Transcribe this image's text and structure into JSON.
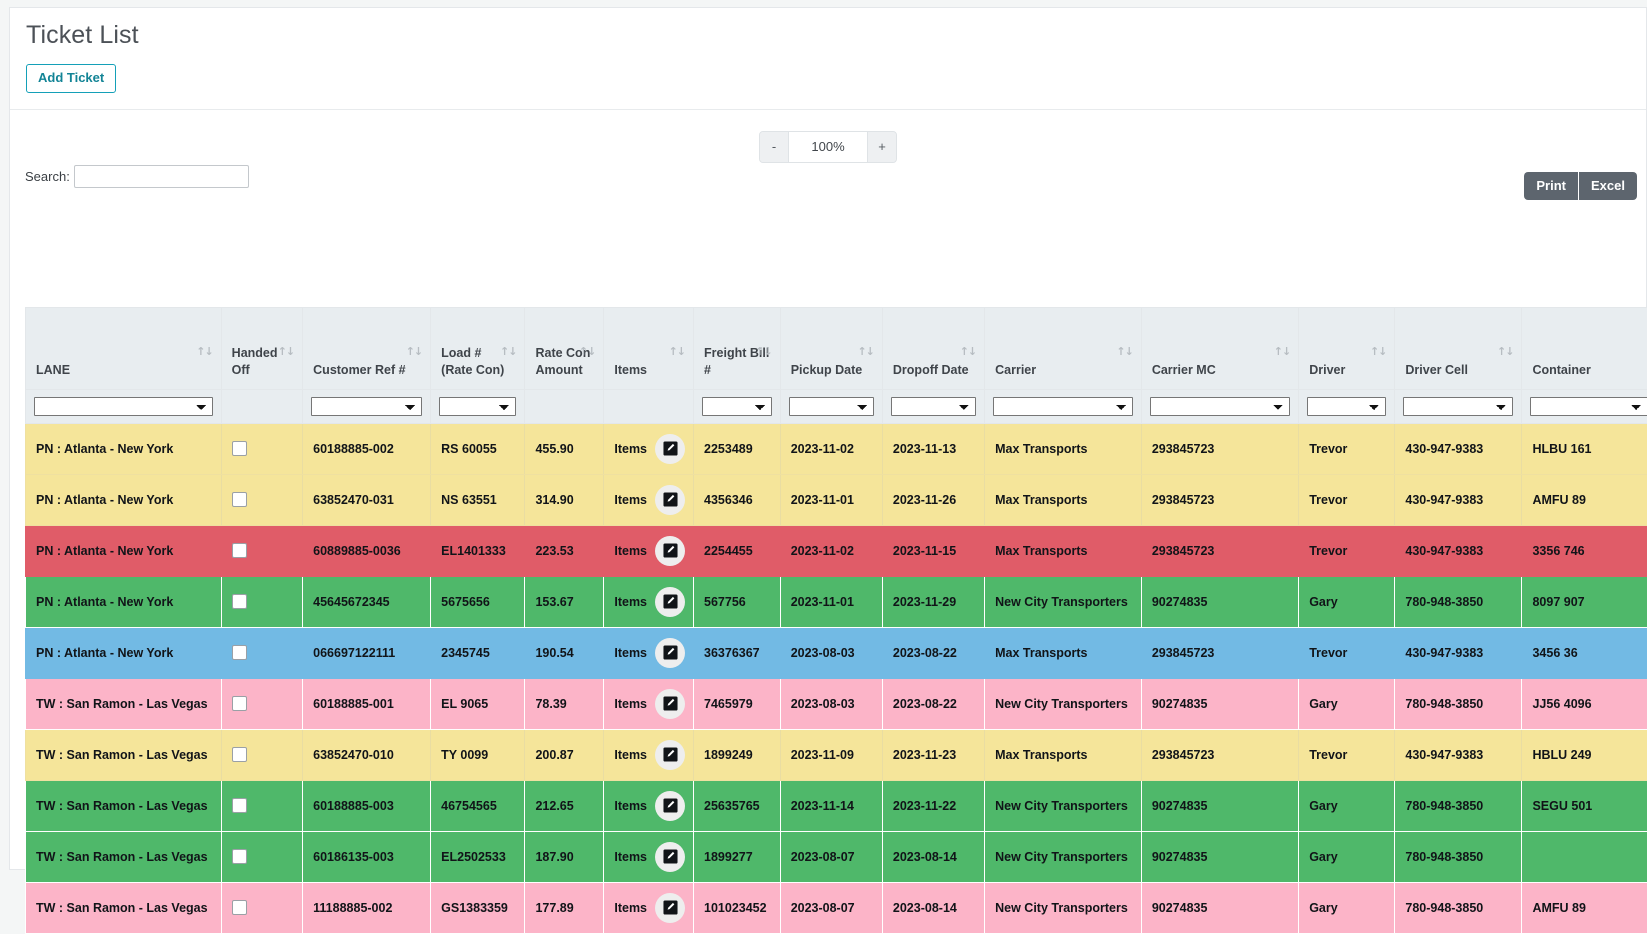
{
  "page": {
    "title": "Ticket List",
    "add_ticket_label": "Add Ticket"
  },
  "zoom": {
    "minus_label": "-",
    "value": "100%",
    "plus_label": "+"
  },
  "export": {
    "print_label": "Print",
    "excel_label": "Excel"
  },
  "search": {
    "label": "Search:",
    "value": "",
    "placeholder": ""
  },
  "table": {
    "columns": [
      {
        "key": "lane",
        "label": "LANE",
        "sortable": true,
        "filter": true
      },
      {
        "key": "handed_off",
        "label": "Handed Off",
        "sortable": true,
        "filter": false
      },
      {
        "key": "customer_ref",
        "label": "Customer Ref #",
        "sortable": true,
        "filter": true
      },
      {
        "key": "load",
        "label": "Load # (Rate Con)",
        "sortable": true,
        "filter": true
      },
      {
        "key": "rate_con_amount",
        "label": "Rate Con Amount",
        "sortable": true,
        "filter": false
      },
      {
        "key": "items",
        "label": "Items",
        "sortable": true,
        "filter": false
      },
      {
        "key": "freight_bill",
        "label": "Freight Bill #",
        "sortable": true,
        "filter": true
      },
      {
        "key": "pickup_date",
        "label": "Pickup Date",
        "sortable": true,
        "filter": true
      },
      {
        "key": "dropoff_date",
        "label": "Dropoff Date",
        "sortable": true,
        "filter": true
      },
      {
        "key": "carrier",
        "label": "Carrier",
        "sortable": true,
        "filter": true
      },
      {
        "key": "carrier_mc",
        "label": "Carrier MC",
        "sortable": true,
        "filter": true
      },
      {
        "key": "driver",
        "label": "Driver",
        "sortable": true,
        "filter": true
      },
      {
        "key": "driver_cell",
        "label": "Driver Cell",
        "sortable": true,
        "filter": true
      },
      {
        "key": "container",
        "label": "Container",
        "sortable": false,
        "filter": true
      }
    ],
    "items_cell_label": "Items",
    "items_edit_icon": "edit-square-icon",
    "sort_icon": "sort-updown-icon",
    "row_colors": {
      "yellow": "#f5e59a",
      "red": "#e05c68",
      "green": "#4fb86a",
      "blue": "#72bae4",
      "pink": "#fcb4c8"
    },
    "rows": [
      {
        "color": "yellow",
        "lane": "PN : Atlanta - New York",
        "handed_off": false,
        "customer_ref": "60188885-002",
        "load": "RS 60055",
        "rate_con_amount": "455.90",
        "items": "Items",
        "freight_bill": "2253489",
        "pickup_date": "2023-11-02",
        "dropoff_date": "2023-11-13",
        "carrier": "Max Transports",
        "carrier_mc": "293845723",
        "driver": "Trevor",
        "driver_cell": "430-947-9383",
        "container": "HLBU 161"
      },
      {
        "color": "yellow",
        "lane": "PN : Atlanta - New York",
        "handed_off": false,
        "customer_ref": "63852470-031",
        "load": "NS 63551",
        "rate_con_amount": "314.90",
        "items": "Items",
        "freight_bill": "4356346",
        "pickup_date": "2023-11-01",
        "dropoff_date": "2023-11-26",
        "carrier": "Max Transports",
        "carrier_mc": "293845723",
        "driver": "Trevor",
        "driver_cell": "430-947-9383",
        "container": "AMFU 89"
      },
      {
        "color": "red",
        "lane": "PN : Atlanta - New York",
        "handed_off": false,
        "customer_ref": "60889885-0036",
        "load": "EL1401333",
        "rate_con_amount": "223.53",
        "items": "Items",
        "freight_bill": "2254455",
        "pickup_date": "2023-11-02",
        "dropoff_date": "2023-11-15",
        "carrier": "Max Transports",
        "carrier_mc": "293845723",
        "driver": "Trevor",
        "driver_cell": "430-947-9383",
        "container": "3356 746"
      },
      {
        "color": "green",
        "lane": "PN : Atlanta - New York",
        "handed_off": false,
        "customer_ref": "45645672345",
        "load": "5675656",
        "rate_con_amount": "153.67",
        "items": "Items",
        "freight_bill": "567756",
        "pickup_date": "2023-11-01",
        "dropoff_date": "2023-11-29",
        "carrier": "New City Transporters",
        "carrier_mc": "90274835",
        "driver": "Gary",
        "driver_cell": "780-948-3850",
        "container": "8097 907"
      },
      {
        "color": "blue",
        "lane": "PN : Atlanta - New York",
        "handed_off": false,
        "customer_ref": "066697122111",
        "load": "2345745",
        "rate_con_amount": "190.54",
        "items": "Items",
        "freight_bill": "36376367",
        "pickup_date": "2023-08-03",
        "dropoff_date": "2023-08-22",
        "carrier": "Max Transports",
        "carrier_mc": "293845723",
        "driver": "Trevor",
        "driver_cell": "430-947-9383",
        "container": "3456 36"
      },
      {
        "color": "pink",
        "lane": "TW : San Ramon - Las Vegas",
        "handed_off": false,
        "customer_ref": "60188885-001",
        "load": "EL 9065",
        "rate_con_amount": "78.39",
        "items": "Items",
        "freight_bill": "7465979",
        "pickup_date": "2023-08-03",
        "dropoff_date": "2023-08-22",
        "carrier": "New City Transporters",
        "carrier_mc": "90274835",
        "driver": "Gary",
        "driver_cell": "780-948-3850",
        "container": "JJ56 4096"
      },
      {
        "color": "yellow",
        "lane": "TW : San Ramon - Las Vegas",
        "handed_off": false,
        "customer_ref": "63852470-010",
        "load": "TY 0099",
        "rate_con_amount": "200.87",
        "items": "Items",
        "freight_bill": "1899249",
        "pickup_date": "2023-11-09",
        "dropoff_date": "2023-11-23",
        "carrier": "Max Transports",
        "carrier_mc": "293845723",
        "driver": "Trevor",
        "driver_cell": "430-947-9383",
        "container": "HBLU 249"
      },
      {
        "color": "green",
        "lane": "TW : San Ramon - Las Vegas",
        "handed_off": false,
        "customer_ref": "60188885-003",
        "load": "46754565",
        "rate_con_amount": "212.65",
        "items": "Items",
        "freight_bill": "25635765",
        "pickup_date": "2023-11-14",
        "dropoff_date": "2023-11-22",
        "carrier": "New City Transporters",
        "carrier_mc": "90274835",
        "driver": "Gary",
        "driver_cell": "780-948-3850",
        "container": "SEGU 501"
      },
      {
        "color": "green",
        "lane": "TW : San Ramon - Las Vegas",
        "handed_off": false,
        "customer_ref": "60186135-003",
        "load": "EL2502533",
        "rate_con_amount": "187.90",
        "items": "Items",
        "freight_bill": "1899277",
        "pickup_date": "2023-08-07",
        "dropoff_date": "2023-08-14",
        "carrier": "New City Transporters",
        "carrier_mc": "90274835",
        "driver": "Gary",
        "driver_cell": "780-948-3850",
        "container": ""
      },
      {
        "color": "pink",
        "lane": "TW : San Ramon - Las Vegas",
        "handed_off": false,
        "customer_ref": "11188885-002",
        "load": "GS1383359",
        "rate_con_amount": "177.89",
        "items": "Items",
        "freight_bill": "101023452",
        "pickup_date": "2023-08-07",
        "dropoff_date": "2023-08-14",
        "carrier": "New City Transporters",
        "carrier_mc": "90274835",
        "driver": "Gary",
        "driver_cell": "780-948-3850",
        "container": "AMFU 89"
      }
    ]
  }
}
